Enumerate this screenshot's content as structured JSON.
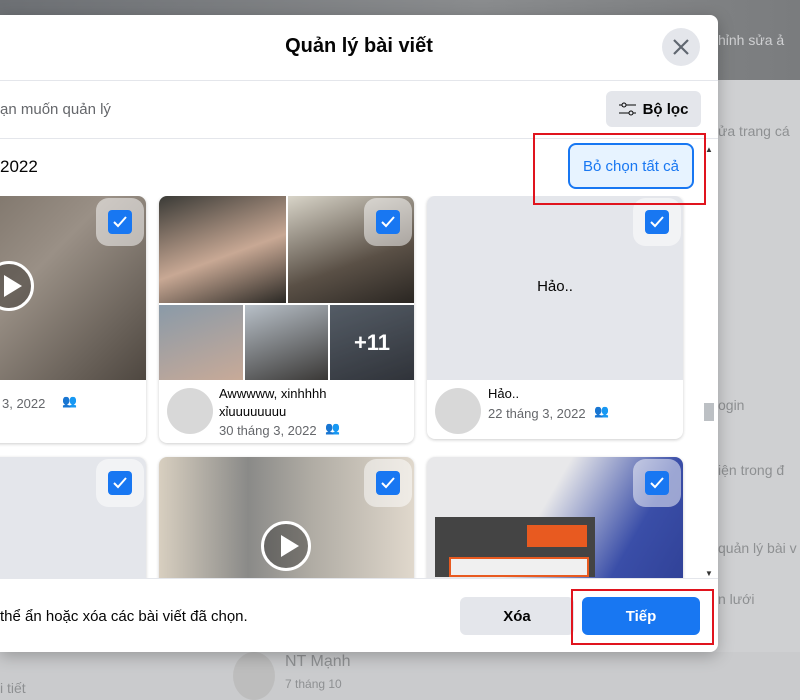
{
  "background": {
    "texts": [
      "hỉnh sửa ả",
      "ửa trang cá",
      "ogin",
      "iện trong đ",
      "quản lý bài v",
      "n lưới",
      "NT Mạnh",
      "7 tháng 10",
      "i tiết"
    ]
  },
  "modal": {
    "title": "Quản lý bài viết",
    "subtitle": "ạn muốn quản lý",
    "filter_label": "Bộ lọc",
    "section_label": "2022",
    "deselect_all_label": "Bỏ chọn tất cả",
    "posts": [
      {
        "type": "video",
        "date": "3, 2022",
        "checked": true
      },
      {
        "type": "album",
        "caption": "Awwwww, xinhhhh xỉuuuuuuuu",
        "more_count": "+11",
        "date": "30 tháng 3, 2022",
        "checked": true
      },
      {
        "type": "text",
        "text": "Hảo..",
        "caption": "Hảo..",
        "date": "22 tháng 3, 2022",
        "checked": true
      },
      {
        "type": "text",
        "checked": true
      },
      {
        "type": "video",
        "checked": true
      },
      {
        "type": "photo",
        "checked": true
      }
    ],
    "footer_text": "thể ẩn hoặc xóa các bài viết đã chọn.",
    "delete_label": "Xóa",
    "next_label": "Tiếp"
  },
  "colors": {
    "accent": "#1877f2",
    "highlight": "#e0141e"
  }
}
